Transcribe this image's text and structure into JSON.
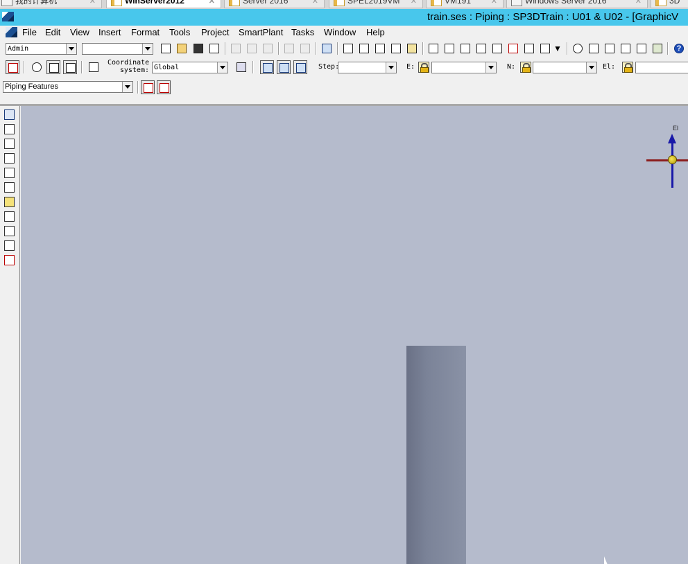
{
  "tabs": [
    {
      "label": "我的计算机"
    },
    {
      "label": "WinServer2012"
    },
    {
      "label": "Server 2016"
    },
    {
      "label": "SPEL2019VM"
    },
    {
      "label": "VM191"
    },
    {
      "label": "Windows Server 2016"
    },
    {
      "label": "3D"
    }
  ],
  "window": {
    "title": "train.ses : Piping : SP3DTrain : U01 & U02 - [GraphicV"
  },
  "menu": [
    "File",
    "Edit",
    "View",
    "Insert",
    "Format",
    "Tools",
    "Project",
    "SmartPlant",
    "Tasks",
    "Window",
    "Help"
  ],
  "toolbar1": {
    "permission_group": "Admin",
    "second_combo": ""
  },
  "toolbar2": {
    "coord_label_line1": "Coordinate",
    "coord_label_line2": "system:",
    "coord_system": "Global",
    "step_label": "Step:",
    "step_value": "",
    "e_label": "E:",
    "e_value": "",
    "n_label": "N:",
    "n_value": "",
    "el_label": "El:",
    "el_value": ""
  },
  "toolbar3": {
    "feature_type": "Piping Features"
  },
  "viewport": {
    "axis_label": "El",
    "background": "#b5bbcc"
  },
  "colors": {
    "titlebar": "#48c7ec",
    "axis_x": "#8b1c1c",
    "axis_z": "#1919a8",
    "origin": "#e3c51a"
  }
}
